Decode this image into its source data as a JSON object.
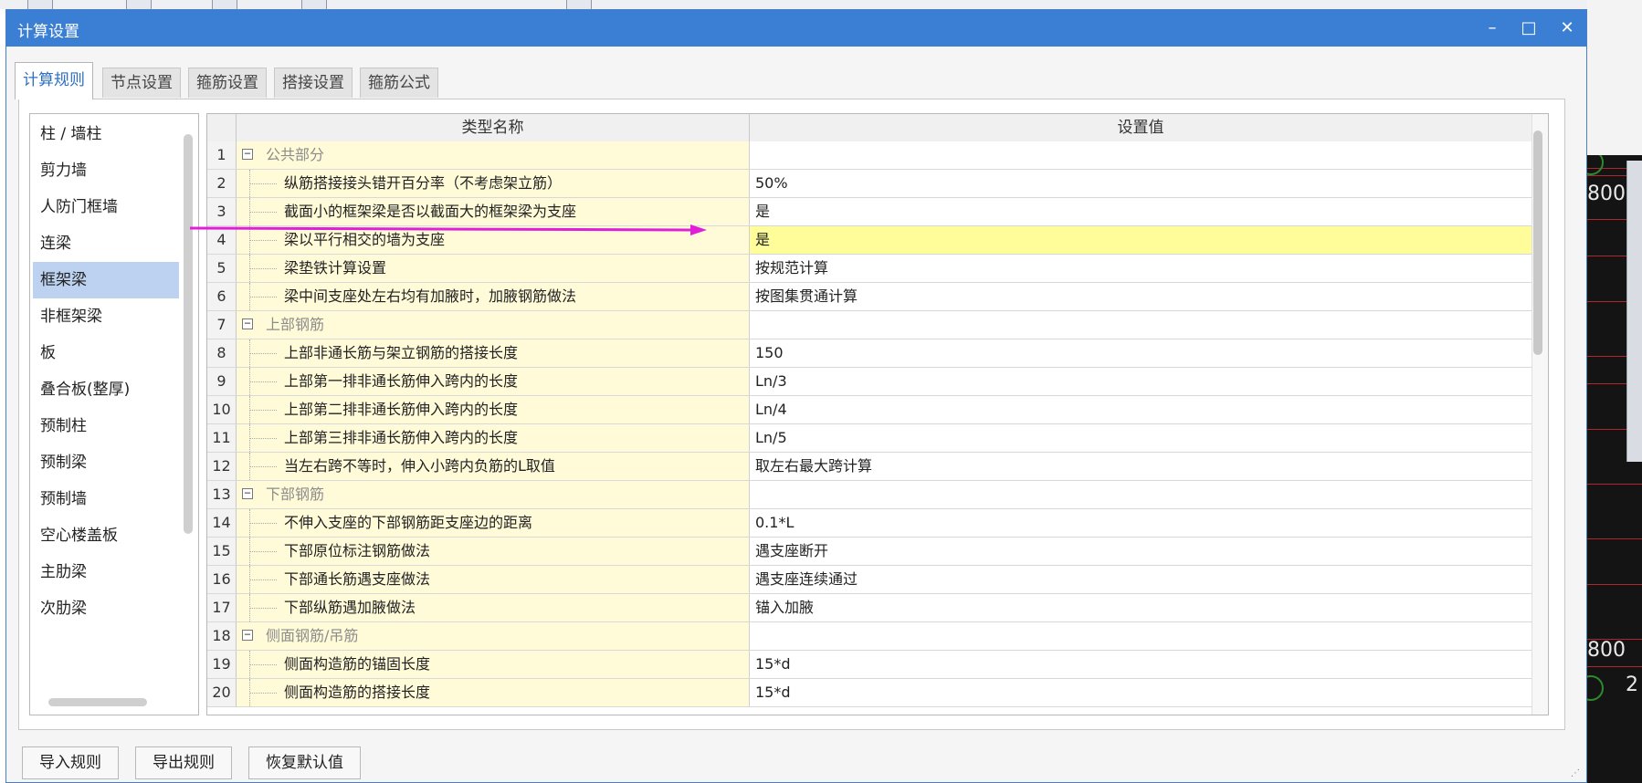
{
  "dialog": {
    "title": "计算设置",
    "minimize": "–",
    "maximize": "□",
    "close": "✕"
  },
  "tabs": [
    {
      "label": "计算规则",
      "active": true
    },
    {
      "label": "节点设置"
    },
    {
      "label": "箍筋设置"
    },
    {
      "label": "搭接设置"
    },
    {
      "label": "箍筋公式"
    }
  ],
  "sidebar": {
    "items": [
      {
        "label": "柱 / 墙柱"
      },
      {
        "label": "剪力墙"
      },
      {
        "label": "人防门框墙"
      },
      {
        "label": "连梁"
      },
      {
        "label": "框架梁",
        "selected": true
      },
      {
        "label": "非框架梁"
      },
      {
        "label": "板"
      },
      {
        "label": "叠合板(整厚)"
      },
      {
        "label": "预制柱"
      },
      {
        "label": "预制梁"
      },
      {
        "label": "预制墙"
      },
      {
        "label": "空心楼盖板"
      },
      {
        "label": "主肋梁"
      },
      {
        "label": "次肋梁"
      }
    ]
  },
  "grid": {
    "headers": {
      "name": "类型名称",
      "value": "设置值"
    },
    "rows": [
      {
        "num": "1",
        "name": "公共部分",
        "value": "",
        "group": true
      },
      {
        "num": "2",
        "name": "纵筋搭接接头错开百分率（不考虑架立筋）",
        "value": "50%"
      },
      {
        "num": "3",
        "name": "截面小的框架梁是否以截面大的框架梁为支座",
        "value": "是"
      },
      {
        "num": "4",
        "name": "梁以平行相交的墙为支座",
        "value": "是",
        "highlight": true
      },
      {
        "num": "5",
        "name": "梁垫铁计算设置",
        "value": "按规范计算"
      },
      {
        "num": "6",
        "name": "梁中间支座处左右均有加腋时，加腋钢筋做法",
        "value": "按图集贯通计算"
      },
      {
        "num": "7",
        "name": "上部钢筋",
        "value": "",
        "group": true
      },
      {
        "num": "8",
        "name": "上部非通长筋与架立钢筋的搭接长度",
        "value": "150"
      },
      {
        "num": "9",
        "name": "上部第一排非通长筋伸入跨内的长度",
        "value": "Ln/3"
      },
      {
        "num": "10",
        "name": "上部第二排非通长筋伸入跨内的长度",
        "value": "Ln/4"
      },
      {
        "num": "11",
        "name": "上部第三排非通长筋伸入跨内的长度",
        "value": "Ln/5"
      },
      {
        "num": "12",
        "name": "当左右跨不等时，伸入小跨内负筋的L取值",
        "value": "取左右最大跨计算"
      },
      {
        "num": "13",
        "name": "下部钢筋",
        "value": "",
        "group": true
      },
      {
        "num": "14",
        "name": "不伸入支座的下部钢筋距支座边的距离",
        "value": "0.1*L"
      },
      {
        "num": "15",
        "name": "下部原位标注钢筋做法",
        "value": "遇支座断开"
      },
      {
        "num": "16",
        "name": "下部通长筋遇支座做法",
        "value": "遇支座连续通过"
      },
      {
        "num": "17",
        "name": "下部纵筋遇加腋做法",
        "value": "锚入加腋"
      },
      {
        "num": "18",
        "name": "侧面钢筋/吊筋",
        "value": "",
        "group": true
      },
      {
        "num": "19",
        "name": "侧面构造筋的锚固长度",
        "value": "15*d"
      },
      {
        "num": "20",
        "name": "侧面构造筋的搭接长度",
        "value": "15*d"
      }
    ]
  },
  "buttons": {
    "import": "导入规则",
    "export": "导出规则",
    "restore": "恢复默认值"
  },
  "background": {
    "cad_label_top": "800",
    "cad_label_bottom": "800",
    "cad_label_bottom2": "2"
  },
  "colors": {
    "title_bar": "#3b7fd5",
    "selected_item": "#bcd2f0",
    "name_cell": "#fffbd8",
    "highlight_row": "#fffc9a",
    "annotation_arrow": "#e020d8"
  }
}
